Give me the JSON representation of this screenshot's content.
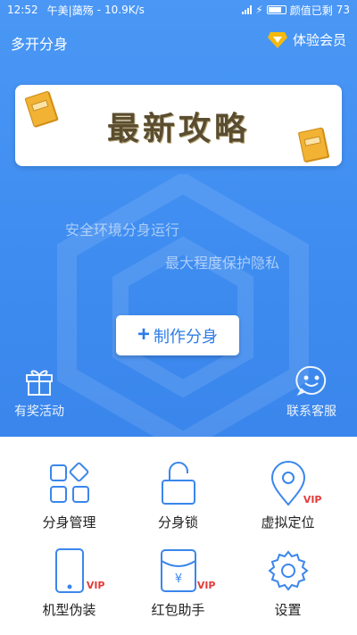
{
  "status_bar": {
    "time": "12:52",
    "carrier": "午美|藹殇",
    "speed": "10.9K/s",
    "right_text": "颜值已剩",
    "battery": "73"
  },
  "header": {
    "title": "多开分身",
    "vip_label": "体验会员"
  },
  "banner": {
    "text": "最新攻略"
  },
  "slogans": {
    "line1": "安全环境分身运行",
    "line2": "最大程度保护隐私"
  },
  "create_button": {
    "label": "制作分身"
  },
  "hero_actions": {
    "rewards": "有奖活动",
    "support": "联系客服"
  },
  "features": [
    {
      "label": "分身管理",
      "icon": "apps-grid-icon",
      "vip": ""
    },
    {
      "label": "分身锁",
      "icon": "lock-icon",
      "vip": ""
    },
    {
      "label": "虚拟定位",
      "icon": "location-pin-icon",
      "vip": "VIP"
    },
    {
      "label": "机型伪装",
      "icon": "phone-icon",
      "vip": "VIP"
    },
    {
      "label": "红包助手",
      "icon": "red-envelope-icon",
      "vip": "VIP"
    },
    {
      "label": "设置",
      "icon": "gear-icon",
      "vip": ""
    }
  ],
  "colors": {
    "hero_bg": "#3e8cf0",
    "accent": "#2d7de6",
    "vip_red": "#e43b3b",
    "vip_gold": "#f6b90d"
  }
}
